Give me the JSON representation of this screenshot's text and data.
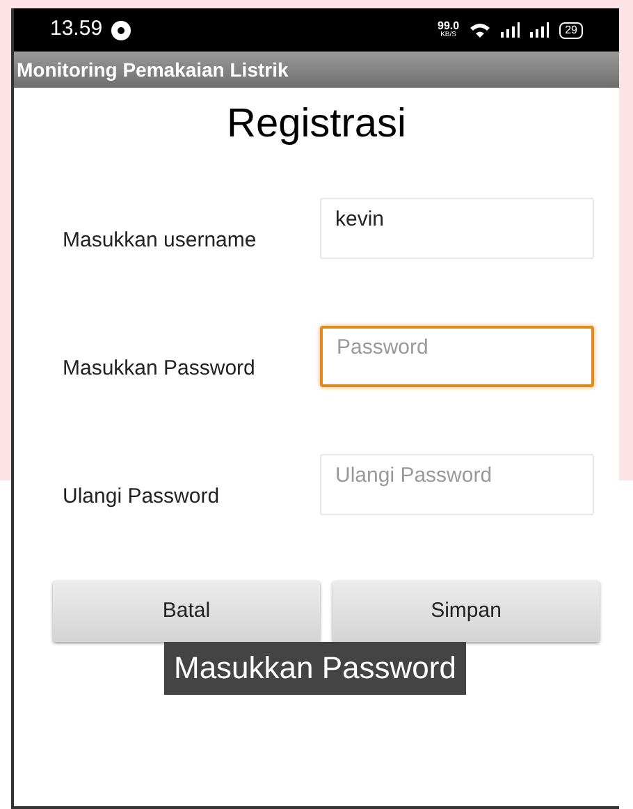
{
  "status_bar": {
    "time": "13.59",
    "speed": "99.0",
    "speed_unit": "KB/S",
    "battery": "29"
  },
  "app_bar": {
    "title": "Monitoring Pemakaian Listrik"
  },
  "heading": "Registrasi",
  "fields": [
    {
      "label": "Masukkan username",
      "value": "kevin",
      "focused": false
    },
    {
      "label": "Masukkan Password",
      "placeholder": "Password",
      "focused": true
    },
    {
      "label": "Ulangi Password",
      "placeholder": "Ulangi Password",
      "focused": false
    }
  ],
  "buttons": [
    "Batal",
    "Simpan"
  ],
  "toast": "Masukkan Password"
}
